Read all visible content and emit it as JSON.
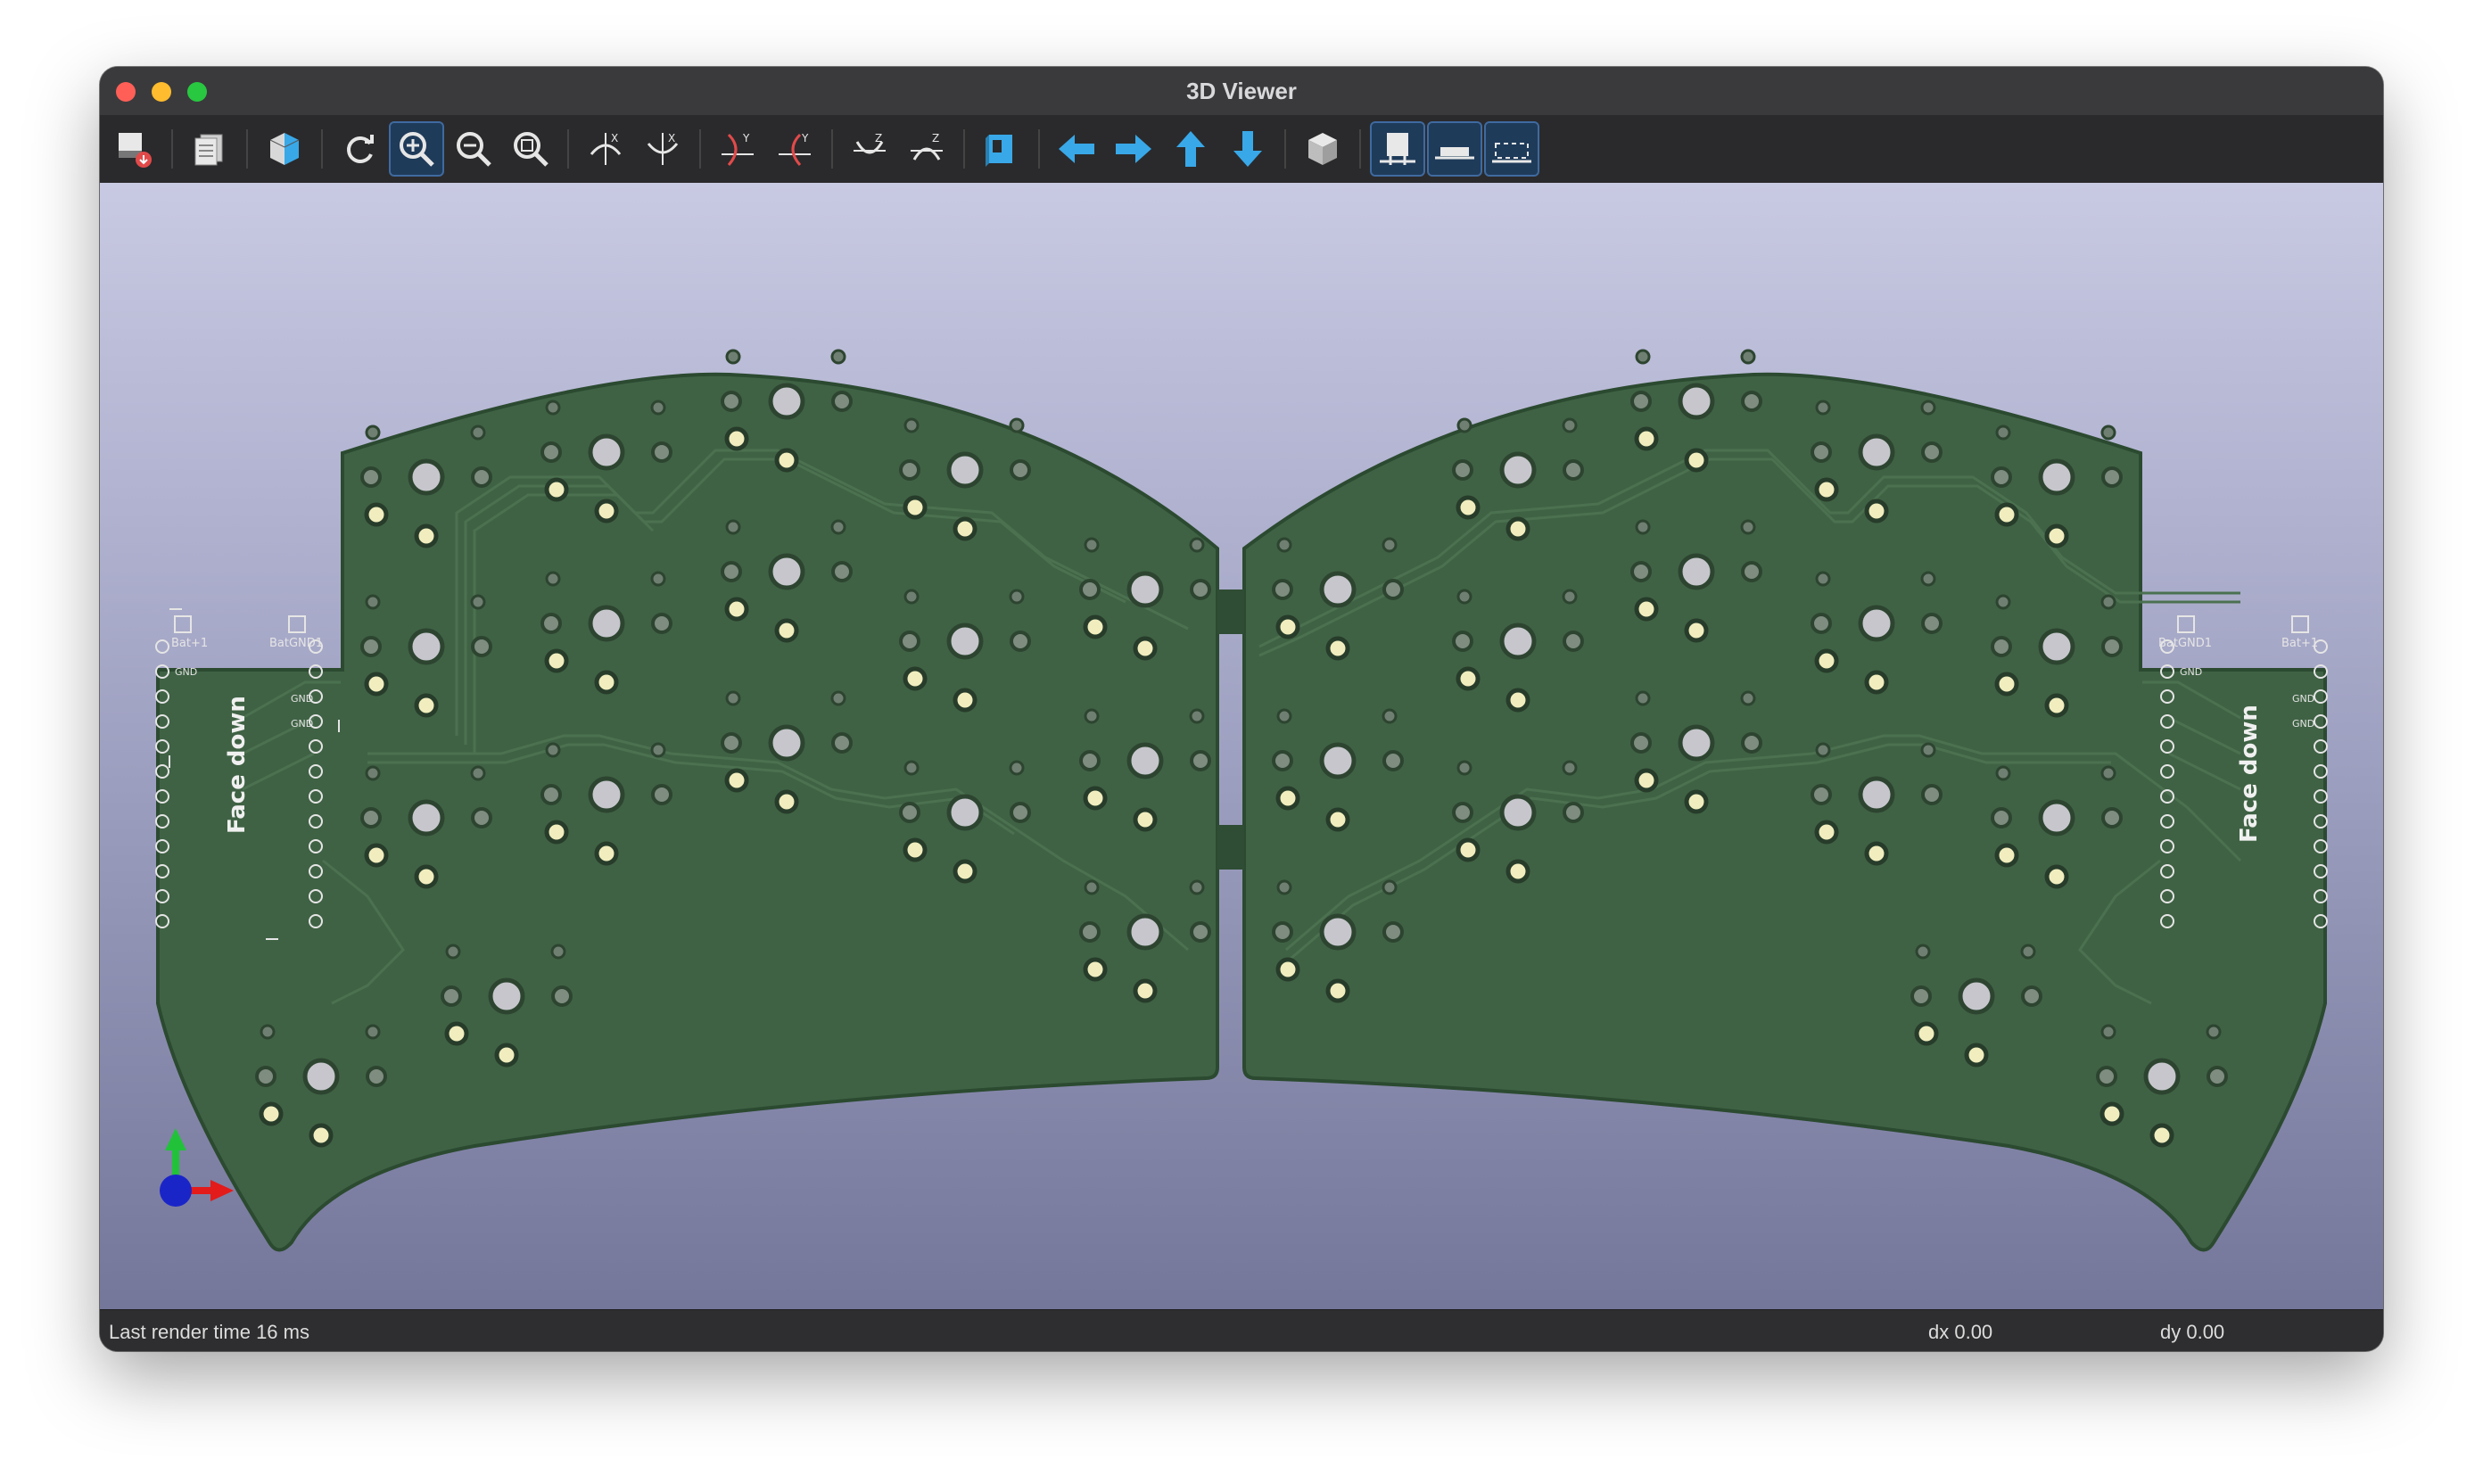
{
  "window": {
    "title": "3D Viewer"
  },
  "toolbar": {
    "buttons": [
      {
        "name": "export-image",
        "icon": "export-icon"
      },
      {
        "name": "copy",
        "icon": "copy-icon"
      },
      {
        "name": "view-mode",
        "icon": "cube-half-icon"
      },
      {
        "name": "reload",
        "icon": "refresh-icon"
      },
      {
        "name": "zoom-in",
        "icon": "zoom-in-icon",
        "active": true
      },
      {
        "name": "zoom-out",
        "icon": "zoom-out-icon"
      },
      {
        "name": "zoom-fit",
        "icon": "zoom-fit-icon"
      },
      {
        "name": "rotate-x-cw",
        "icon": "rotate-x-icon"
      },
      {
        "name": "rotate-x-ccw",
        "icon": "rotate-x-icon"
      },
      {
        "name": "rotate-y-cw",
        "icon": "rotate-y-icon"
      },
      {
        "name": "rotate-y-ccw",
        "icon": "rotate-y-icon"
      },
      {
        "name": "rotate-z-cw",
        "icon": "rotate-z-icon"
      },
      {
        "name": "rotate-z-ccw",
        "icon": "rotate-z-icon"
      },
      {
        "name": "flip-board",
        "icon": "flip-icon"
      },
      {
        "name": "move-left",
        "icon": "arrow-left-icon"
      },
      {
        "name": "move-right",
        "icon": "arrow-right-icon"
      },
      {
        "name": "move-up",
        "icon": "arrow-up-icon"
      },
      {
        "name": "move-down",
        "icon": "arrow-down-icon"
      },
      {
        "name": "orthographic",
        "icon": "cube-icon"
      },
      {
        "name": "show-tht",
        "icon": "tht-icon",
        "active": true
      },
      {
        "name": "show-smd",
        "icon": "smd-icon",
        "active": true
      },
      {
        "name": "show-virtual",
        "icon": "virtual-icon",
        "active": true
      }
    ]
  },
  "board": {
    "left_silk": {
      "label": "Face down",
      "pin_top_left": "Bat+1",
      "pin_top_right": "BatGND1",
      "gnd": "GND"
    },
    "right_silk": {
      "label": "Face down",
      "pin_top_left": "BatGND1",
      "pin_top_right": "Bat+1",
      "gnd": "GND"
    }
  },
  "status": {
    "render_time": "Last render time 16 ms",
    "dx": "dx 0.00",
    "dy": "dy 0.00"
  },
  "colors": {
    "pcb": "#3f6244",
    "pad": "#e9e6b0",
    "viewport_top": "#c8c9e2",
    "viewport_bottom": "#74769a",
    "icon_blue": "#39a8e8"
  }
}
